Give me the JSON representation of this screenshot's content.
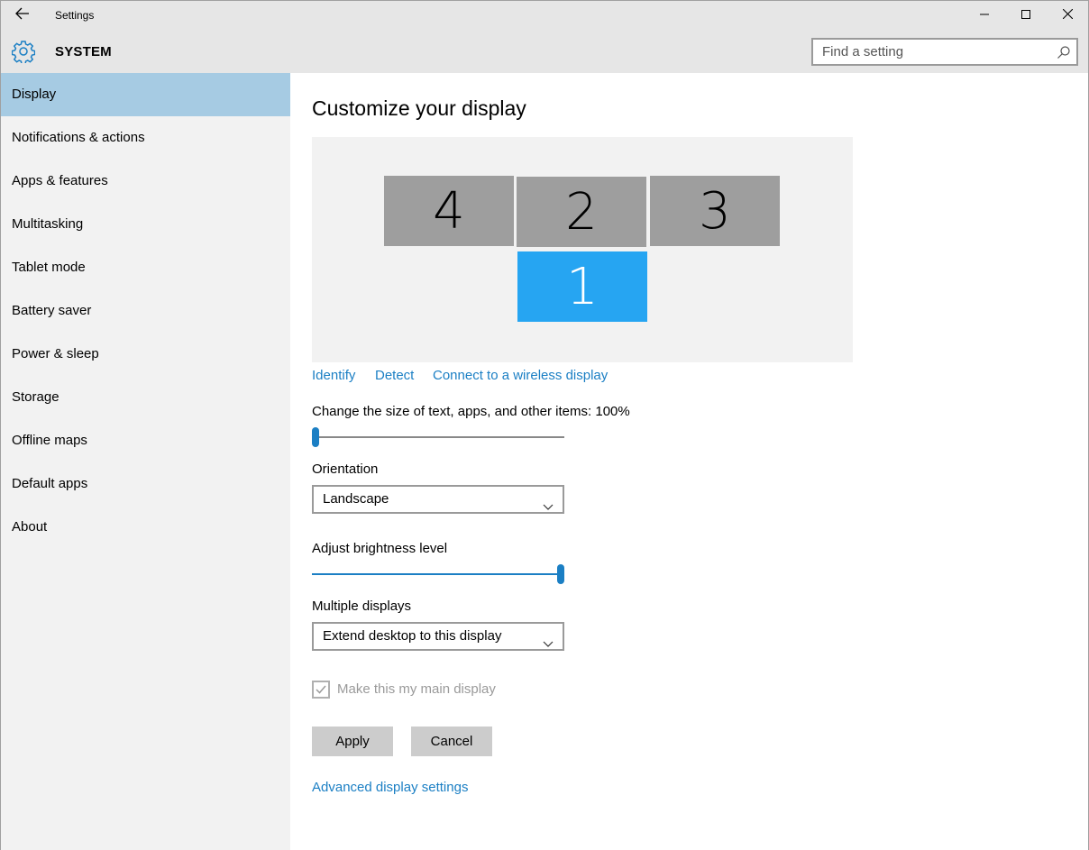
{
  "window": {
    "title": "Settings",
    "icons": {
      "back": "back-arrow-icon",
      "minimize": "minimize-icon",
      "maximize": "maximize-icon",
      "close": "close-icon"
    }
  },
  "header": {
    "section_title": "SYSTEM",
    "section_icon": "gear-icon",
    "search": {
      "placeholder": "Find a setting",
      "value": "",
      "icon": "search-icon"
    }
  },
  "sidebar": {
    "items": [
      {
        "label": "Display",
        "active": true
      },
      {
        "label": "Notifications & actions",
        "active": false
      },
      {
        "label": "Apps & features",
        "active": false
      },
      {
        "label": "Multitasking",
        "active": false
      },
      {
        "label": "Tablet mode",
        "active": false
      },
      {
        "label": "Battery saver",
        "active": false
      },
      {
        "label": "Power & sleep",
        "active": false
      },
      {
        "label": "Storage",
        "active": false
      },
      {
        "label": "Offline maps",
        "active": false
      },
      {
        "label": "Default apps",
        "active": false
      },
      {
        "label": "About",
        "active": false
      }
    ]
  },
  "main": {
    "title": "Customize your display",
    "monitors": [
      {
        "number": "4",
        "selected": false
      },
      {
        "number": "2",
        "selected": false
      },
      {
        "number": "3",
        "selected": false
      },
      {
        "number": "1",
        "selected": true
      }
    ],
    "links": {
      "identify": "Identify",
      "detect": "Detect",
      "wireless": "Connect to a wireless display",
      "advanced": "Advanced display settings"
    },
    "scale": {
      "label": "Change the size of text, apps, and other items: 100%",
      "slider_level": 0.0
    },
    "orientation": {
      "label": "Orientation",
      "value": "Landscape"
    },
    "brightness": {
      "label": "Adjust brightness level",
      "slider_level": 1.0
    },
    "multiple_displays": {
      "label": "Multiple displays",
      "value": "Extend desktop to this display"
    },
    "main_display": {
      "label": "Make this my main display",
      "checked": true,
      "disabled": true
    },
    "buttons": {
      "apply": "Apply",
      "cancel": "Cancel"
    }
  },
  "colors": {
    "accent": "#1b7fc4",
    "selected_monitor": "#26a5f2",
    "active_nav": "#a6cbe3",
    "monitor": "#9e9e9e",
    "sidebar_bg": "#f2f2f2",
    "header_bg": "#e6e6e6"
  }
}
